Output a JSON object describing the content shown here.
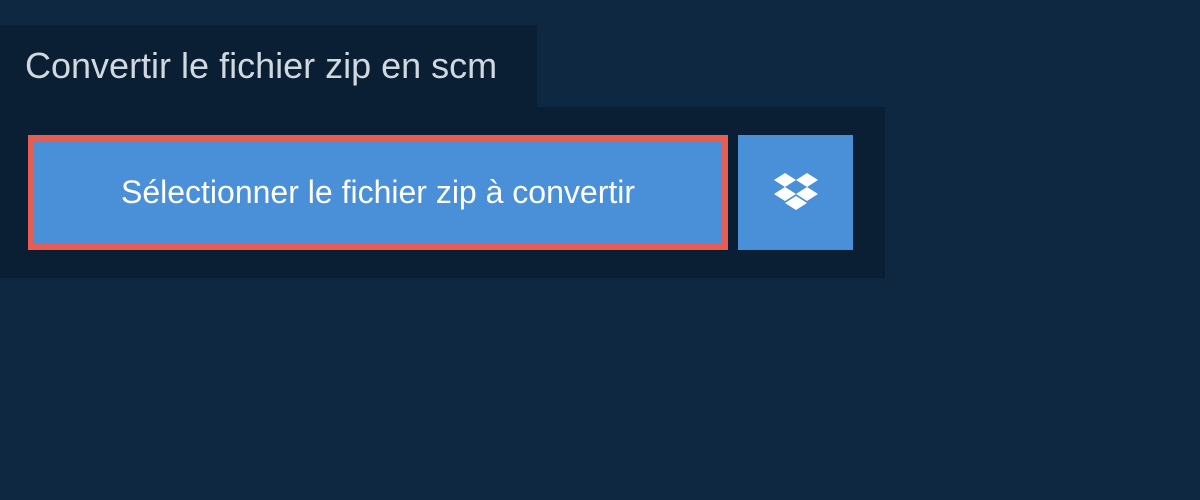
{
  "header": {
    "title": "Convertir le fichier zip en scm"
  },
  "buttons": {
    "select_file_label": "Sélectionner le fichier zip à convertir"
  }
}
